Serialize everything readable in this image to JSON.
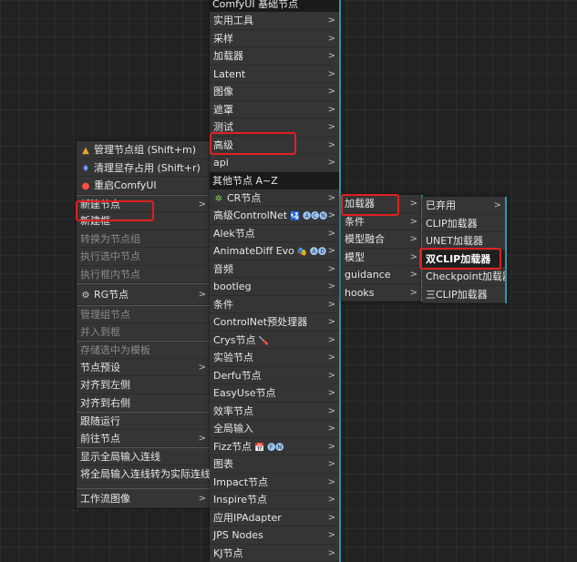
{
  "menu_left": {
    "items": [
      {
        "label": "管理节点组 (Shift+m)",
        "icon": "group-icon",
        "disabled": false,
        "sub": false
      },
      {
        "label": "清理显存占用 (Shift+r)",
        "icon": "rocket-icon",
        "disabled": false,
        "sub": false
      },
      {
        "label": "重启ComfyUI",
        "icon": "restart-icon",
        "disabled": false,
        "sub": false
      },
      {
        "label": "新建节点",
        "disabled": false,
        "sub": true
      },
      {
        "label": "新建框",
        "disabled": false,
        "sub": false
      },
      {
        "label": "转换为节点组",
        "disabled": true,
        "sub": false
      },
      {
        "label": "执行选中节点",
        "disabled": true,
        "sub": false
      },
      {
        "label": "执行框内节点",
        "disabled": true,
        "sub": false
      },
      {
        "label": "RG节点",
        "icon": "rg-icon",
        "disabled": false,
        "sub": true
      },
      {
        "label": "管理组节点",
        "disabled": true,
        "sub": false
      },
      {
        "label": "并入到框",
        "disabled": true,
        "sub": false
      },
      {
        "label": "存储选中为模板",
        "disabled": true,
        "sub": false
      },
      {
        "label": "节点预设",
        "disabled": false,
        "sub": true
      },
      {
        "label": "对齐到左侧",
        "disabled": false,
        "sub": false
      },
      {
        "label": "对齐到右侧",
        "disabled": false,
        "sub": false
      },
      {
        "label": "跟随运行",
        "disabled": false,
        "sub": false
      },
      {
        "label": "前往节点",
        "disabled": false,
        "sub": true
      },
      {
        "label": "显示全局输入连线",
        "disabled": false,
        "sub": false
      },
      {
        "label": "将全局输入连线转为实际连线",
        "disabled": false,
        "sub": false
      },
      {
        "label": "工作流图像",
        "disabled": false,
        "sub": true
      }
    ]
  },
  "menu_main": {
    "header1": "ComfyUI 基础节点",
    "base_items": [
      "实用工具",
      "采样",
      "加载器",
      "Latent",
      "图像",
      "遮罩",
      "测试",
      "高级",
      "api"
    ],
    "header2": "其他节点 A~Z",
    "other_items": [
      {
        "label": "CR节点",
        "icon": "puzzle-icon"
      },
      {
        "label": "高级ControlNet",
        "badge": "🛂 🅐🅒🅝"
      },
      {
        "label": "Alek节点"
      },
      {
        "label": "AnimateDiff Evo",
        "badge": "🎭 🅐🅓"
      },
      {
        "label": "音频"
      },
      {
        "label": "bootleg"
      },
      {
        "label": "条件"
      },
      {
        "label": "ControlNet预处理器"
      },
      {
        "label": "Crys节点",
        "badge": "🪛"
      },
      {
        "label": "实验节点"
      },
      {
        "label": "Derfu节点"
      },
      {
        "label": "EasyUse节点"
      },
      {
        "label": "效率节点"
      },
      {
        "label": "全局输入"
      },
      {
        "label": "Fizz节点",
        "badge": "📅 🅕🅝"
      },
      {
        "label": "图表"
      },
      {
        "label": "Impact节点"
      },
      {
        "label": "Inspire节点"
      },
      {
        "label": "应用IPAdapter"
      },
      {
        "label": "JPS Nodes"
      },
      {
        "label": "KJ节点"
      }
    ]
  },
  "menu_adv": {
    "items": [
      "加载器",
      "条件",
      "模型融合",
      "模型",
      "guidance",
      "hooks"
    ]
  },
  "menu_loaders": {
    "items": [
      "已弃用",
      "CLIP加载器",
      "UNET加载器",
      "双CLIP加载器",
      "Checkpoint加载器",
      "三CLIP加载器"
    ]
  },
  "chevron": ">"
}
